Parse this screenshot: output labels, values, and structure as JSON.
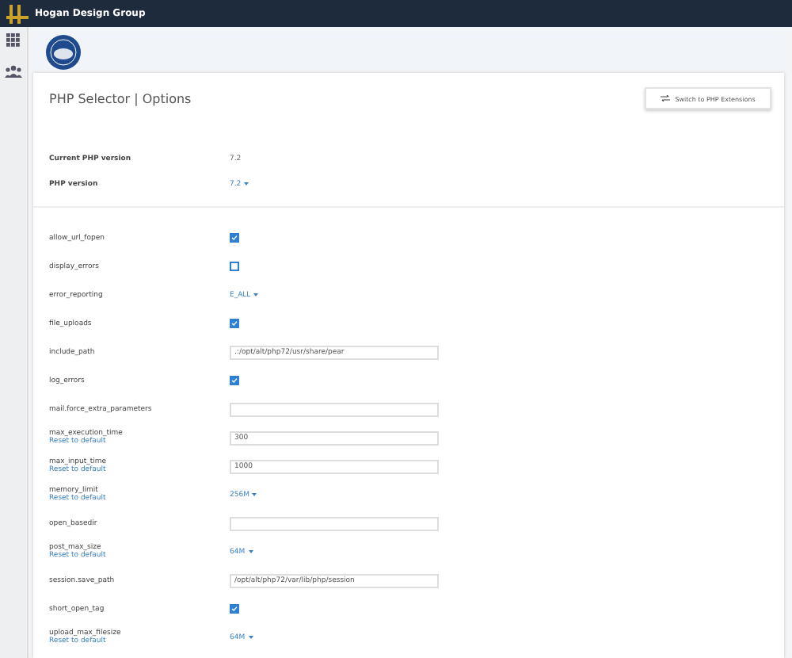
{
  "topbar": {
    "brand": "Hogan Design Group"
  },
  "page": {
    "title": "PHP Selector | Options",
    "switch_button": "Switch to PHP Extensions"
  },
  "versions": [
    {
      "label": "Current PHP version",
      "value": "7.2",
      "kind": "text"
    },
    {
      "label": "PHP version",
      "value": "7.2",
      "kind": "select"
    }
  ],
  "options": [
    {
      "name": "allow_url_fopen",
      "kind": "checkbox",
      "checked": true
    },
    {
      "name": "display_errors",
      "kind": "checkbox",
      "checked": false
    },
    {
      "name": "error_reporting",
      "kind": "select",
      "value": "E_ALL"
    },
    {
      "name": "file_uploads",
      "kind": "checkbox",
      "checked": true
    },
    {
      "name": "include_path",
      "kind": "input",
      "value": ".:/opt/alt/php72/usr/share/pear"
    },
    {
      "name": "log_errors",
      "kind": "checkbox",
      "checked": true
    },
    {
      "name": "mail.force_extra_parameters",
      "kind": "input"
    },
    {
      "name": "max_execution_time",
      "kind": "input",
      "value": "300",
      "reset": "Reset to default"
    },
    {
      "name": "max_input_time",
      "kind": "input",
      "value": "1000",
      "reset": "Reset to default"
    },
    {
      "name": "memory_limit",
      "kind": "select",
      "value": "256M",
      "reset": "Reset to default"
    },
    {
      "name": "open_basedir",
      "kind": "input"
    },
    {
      "name": "post_max_size",
      "kind": "select",
      "value": "64M",
      "reset": "Reset to default"
    },
    {
      "name": "session.save_path",
      "kind": "input",
      "value": "/opt/alt/php72/var/lib/php/session"
    },
    {
      "name": "short_open_tag",
      "kind": "checkbox",
      "checked": true
    },
    {
      "name": "upload_max_filesize",
      "kind": "select",
      "value": "64M",
      "reset": "Reset to default"
    }
  ]
}
